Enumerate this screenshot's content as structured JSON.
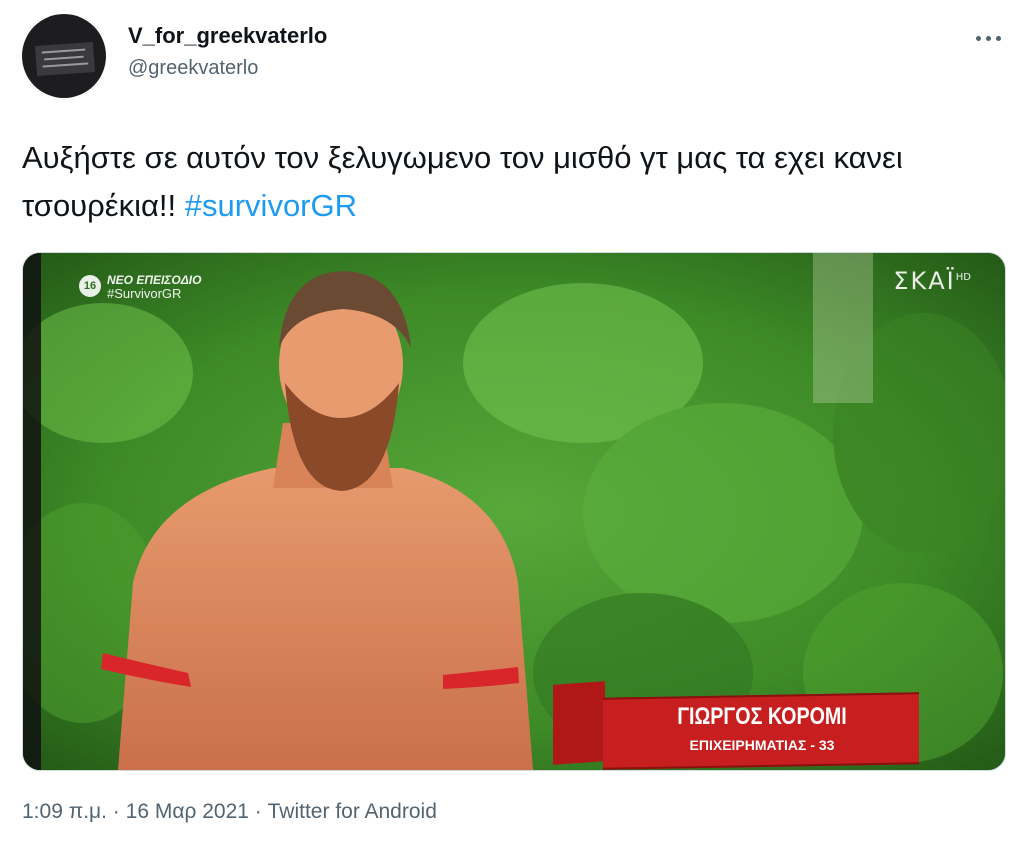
{
  "author": {
    "display_name": "V_for_greekvaterlo",
    "handle": "@greekvaterlo"
  },
  "tweet": {
    "text_main": "Αυξήστε σε αυτόν τον ξελυγωμενο τον μισθό γτ μας τα εχει κανει τσουρέκια!! ",
    "hashtag": "#survivorGR"
  },
  "media": {
    "episode_badge": "16",
    "episode_label": "ΝΕΟ ΕΠΕΙΣΟΔΙΟ",
    "episode_tag": "#SurvivorGR",
    "channel_logo": "ΣΚΑΪ",
    "channel_hd": "HD",
    "lower_third_name": "ΓΙΩΡΓΟΣ ΚΟΡΟΜΙ",
    "lower_third_job": "ΕΠΙΧΕΙΡΗΜΑΤΙΑΣ - 33"
  },
  "footer": {
    "time": "1:09 π.μ.",
    "sep1": " · ",
    "date": "16 Μαρ 2021",
    "sep2": " · ",
    "source": "Twitter for Android"
  },
  "icons": {
    "more": "more-options-icon"
  },
  "colors": {
    "hashtag": "#1d9bf0",
    "secondary_text": "#536471",
    "lower_third": "#c71f1f"
  }
}
